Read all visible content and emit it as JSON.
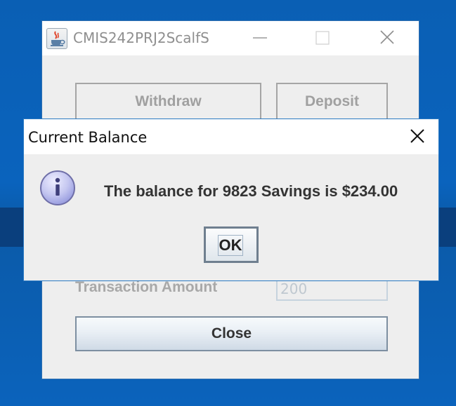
{
  "main_window": {
    "title": "CMIS242PRJ2ScalfS",
    "buttons": {
      "withdraw": "Withdraw",
      "deposit": "Deposit",
      "close": "Close"
    },
    "transaction_amount_label": "Transaction Amount",
    "transaction_amount_value": "200",
    "icons": [
      "java-app-icon",
      "minimize-icon",
      "maximize-icon",
      "close-icon"
    ]
  },
  "dialog": {
    "title": "Current Balance",
    "message": "The balance for 9823 Savings is $234.00",
    "ok_label": "OK",
    "icons": [
      "info-icon",
      "close-icon"
    ]
  },
  "colors": {
    "desktop": "#0a63bd",
    "window_background": "#eeeeee",
    "title_bar": "#ffffff",
    "border_accent": "#2b79c2"
  }
}
